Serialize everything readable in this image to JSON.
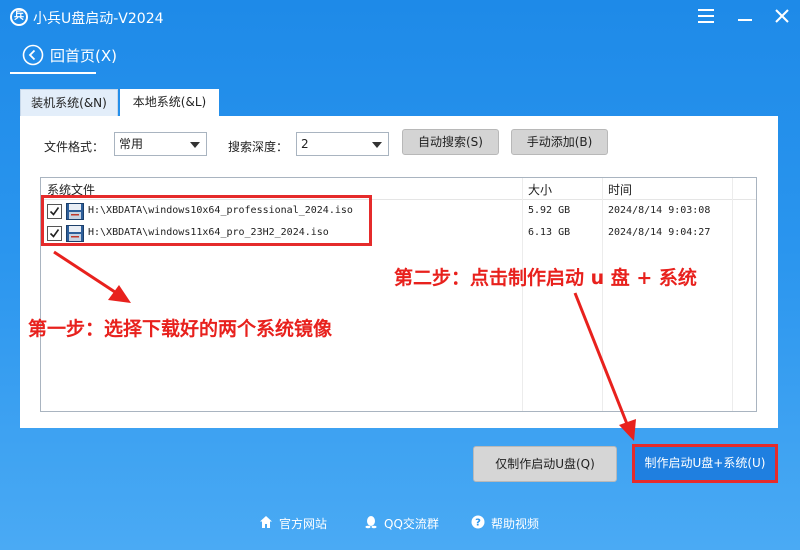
{
  "window": {
    "title": "小兵U盘启动-V2024",
    "logo_text": "兵"
  },
  "nav": {
    "home_label": "回首页(X)"
  },
  "tabs": [
    {
      "label": "装机系统(&N)",
      "active": false
    },
    {
      "label": "本地系统(&L)",
      "active": true
    }
  ],
  "filters": {
    "format_label": "文件格式：",
    "format_value": "常用",
    "depth_label": "搜索深度：",
    "depth_value": "2",
    "auto_search": "自动搜索(S)",
    "manual_add": "手动添加(B)"
  },
  "file_list": {
    "columns": [
      "系统文件",
      "大小",
      "时间"
    ],
    "rows": [
      {
        "checked": true,
        "path": "H:\\XBDATA\\windows10x64_professional_2024.iso",
        "size": "5.92 GB",
        "time": "2024/8/14 9:03:08"
      },
      {
        "checked": true,
        "path": "H:\\XBDATA\\windows11x64_pro_23H2_2024.iso",
        "size": "6.13 GB",
        "time": "2024/8/14 9:04:27"
      }
    ]
  },
  "annotations": {
    "step1": "第一步：选择下载好的两个系统镜像",
    "step2": "第二步：点击制作启动 u 盘 + 系统"
  },
  "actions": {
    "only_make": "仅制作启动U盘(Q)",
    "make_with_system": "制作启动U盘+系统(U)"
  },
  "footer": {
    "official_site": "官方网站",
    "qq_group": "QQ交流群",
    "help_video": "帮助视频"
  },
  "colors": {
    "accent_blue": "#1f7fe0",
    "annotation_red": "#e8211d"
  }
}
